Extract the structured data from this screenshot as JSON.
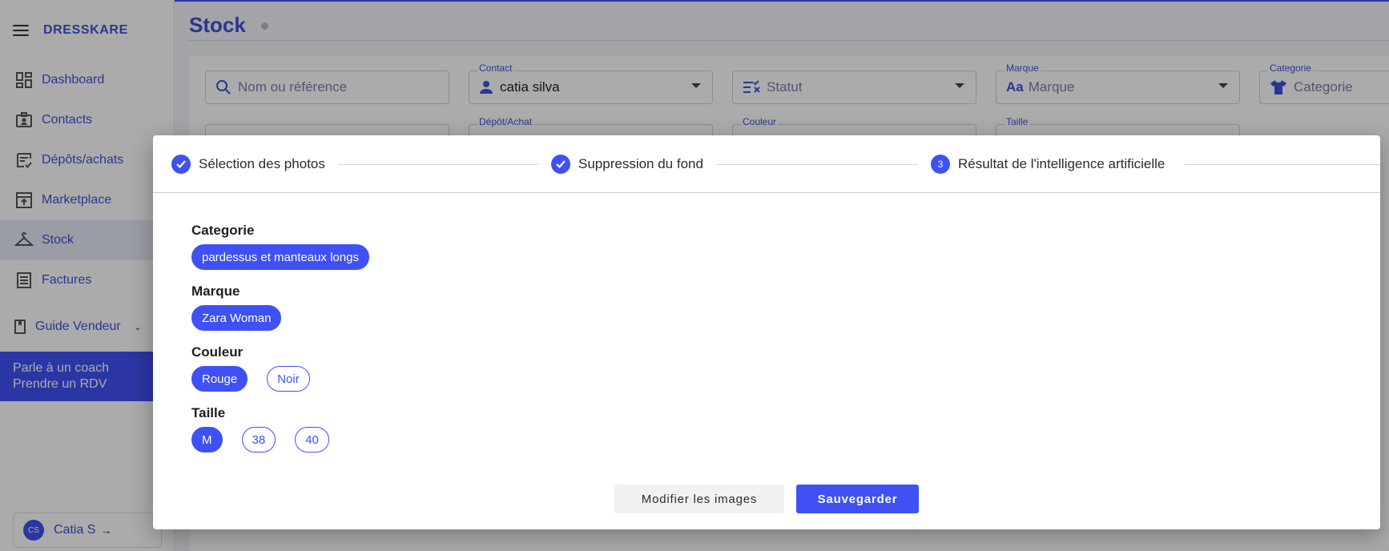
{
  "app": {
    "brand": "DRESSKARE"
  },
  "sidebar": {
    "items": [
      {
        "label": "Dashboard",
        "icon": "dashboard-icon"
      },
      {
        "label": "Contacts",
        "icon": "contacts-icon"
      },
      {
        "label": "Dépôts/achats",
        "icon": "deposits-icon"
      },
      {
        "label": "Marketplace",
        "icon": "marketplace-icon"
      },
      {
        "label": "Stock",
        "icon": "hanger-icon",
        "active": true
      },
      {
        "label": "Factures",
        "icon": "invoices-icon"
      }
    ],
    "guide": {
      "label": "Guide Vendeur",
      "icon": "guide-icon"
    },
    "coach": {
      "line1": "Parle à un coach",
      "line2": "Prendre un RDV"
    },
    "user": {
      "initials": "CS",
      "name": "Catia S"
    }
  },
  "page": {
    "title": "Stock"
  },
  "filters": {
    "search": {
      "placeholder": "Nom ou référence"
    },
    "contact": {
      "label": "Contact",
      "value": "catia silva"
    },
    "statut": {
      "placeholder": "Statut"
    },
    "marque": {
      "label": "Marque",
      "placeholder": "Marque"
    },
    "categorie": {
      "label": "Categorie",
      "placeholder": "Categorie"
    },
    "depot": {
      "label": "Dépôt/Achat"
    },
    "couleur": {
      "label": "Couleur"
    },
    "taille": {
      "label": "Taille"
    }
  },
  "modal": {
    "steps": [
      {
        "label": "Sélection des photos",
        "state": "done"
      },
      {
        "label": "Suppression du fond",
        "state": "done"
      },
      {
        "label": "Résultat de l'intelligence artificielle",
        "number": "3",
        "state": "active"
      }
    ],
    "sections": {
      "categorie": {
        "label": "Categorie",
        "options": [
          {
            "label": "pardessus et manteaux longs",
            "selected": true
          }
        ]
      },
      "marque": {
        "label": "Marque",
        "options": [
          {
            "label": "Zara Woman",
            "selected": true
          }
        ]
      },
      "couleur": {
        "label": "Couleur",
        "options": [
          {
            "label": "Rouge",
            "selected": true
          },
          {
            "label": "Noir",
            "selected": false
          }
        ]
      },
      "taille": {
        "label": "Taille",
        "options": [
          {
            "label": "M",
            "selected": true
          },
          {
            "label": "38",
            "selected": false
          },
          {
            "label": "40",
            "selected": false
          }
        ]
      }
    },
    "buttons": {
      "secondary": "Modifier les images",
      "primary": "Sauvegarder"
    }
  },
  "colors": {
    "accent": "#3f51f5",
    "brand_text": "#3f51d8",
    "backdrop": "rgba(0,0,0,0.33)"
  }
}
